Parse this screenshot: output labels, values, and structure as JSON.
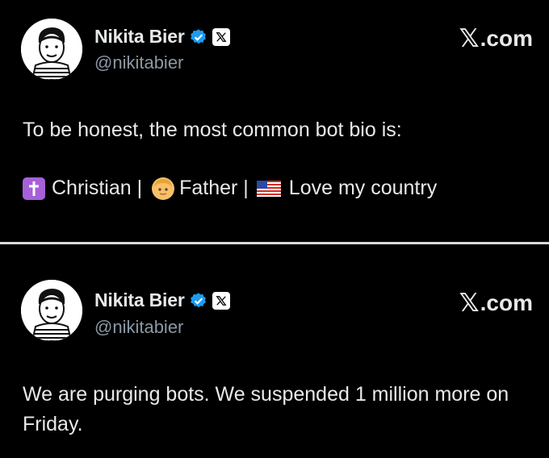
{
  "posts": [
    {
      "author": {
        "display_name": "Nikita Bier",
        "handle": "@nikitabier"
      },
      "brand": ".com",
      "brand_x": "𝕏",
      "text_line1": "To be honest, the most common bot bio is:",
      "bio": {
        "part1": "Christian |",
        "part2": "Father |",
        "part3": "Love my country"
      }
    },
    {
      "author": {
        "display_name": "Nikita Bier",
        "handle": "@nikitabier"
      },
      "brand": ".com",
      "brand_x": "𝕏",
      "text": "We are purging bots. We suspended 1 million more on Friday."
    }
  ],
  "colors": {
    "background": "#000000",
    "text": "#e7e9ea",
    "handle": "#8b98a5",
    "verified": "#1d9bf0",
    "divider": "#d9d9d9"
  },
  "icons": [
    "avatar",
    "verified-badge-icon",
    "x-affiliate-badge-icon",
    "cross-emoji-icon",
    "man-emoji-icon",
    "us-flag-icon"
  ]
}
